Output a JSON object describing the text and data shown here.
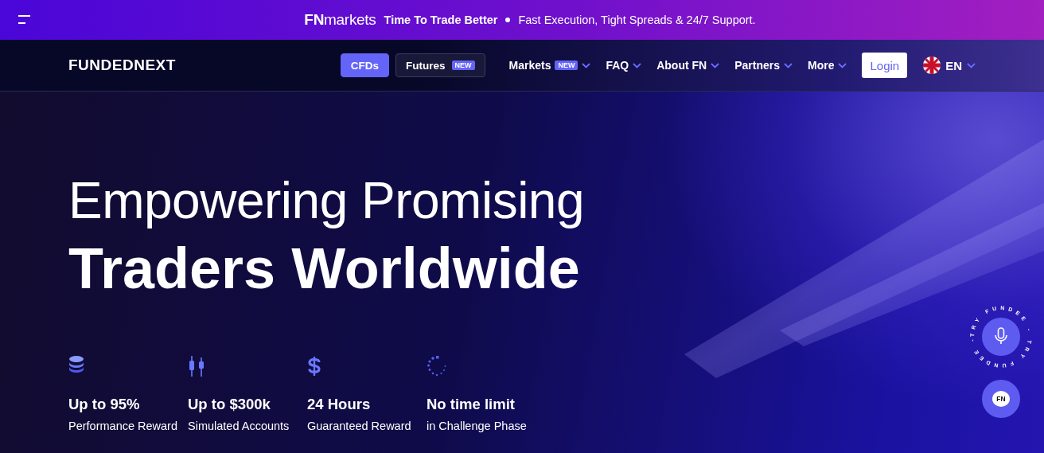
{
  "banner": {
    "brand": "**FN**markets",
    "headline": "Time To Trade Better",
    "tagline": "Fast Execution, Tight Spreads & 24/7 Support."
  },
  "nav": {
    "logo": "FUNDEDNEXT",
    "segments": [
      {
        "label": "CFDs",
        "selected": true
      },
      {
        "label": "Futures",
        "badge": "NEW",
        "selected": false
      }
    ],
    "menu": [
      {
        "label": "Markets",
        "badge": "NEW"
      },
      {
        "label": "FAQ"
      },
      {
        "label": "About FN"
      },
      {
        "label": "Partners"
      },
      {
        "label": "More"
      }
    ],
    "login": "Login",
    "language": "EN"
  },
  "hero": {
    "title_line_1": "Empowering Promising",
    "title_line_2": "Traders Worldwide",
    "stats": [
      {
        "kind": "coins",
        "value": "Up to 95%",
        "description": "Performance Reward"
      },
      {
        "kind": "candles",
        "value": "Up to $300k",
        "description": "Simulated Accounts"
      },
      {
        "kind": "dollar",
        "value": "24 Hours",
        "description": "Guaranteed Reward"
      },
      {
        "kind": "spinner",
        "value": "No time limit",
        "description": "in Challenge Phase"
      }
    ]
  },
  "assistant": {
    "ring_text": "TRY FUNDEE - TRY FUNDEE - ",
    "chat_badge": "FN"
  }
}
